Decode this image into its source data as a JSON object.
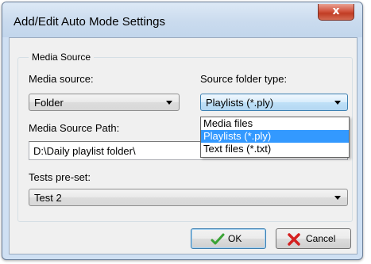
{
  "window": {
    "title": "Add/Edit Auto Mode Settings",
    "close_glyph": "x"
  },
  "group": {
    "legend": "Media Source"
  },
  "media_source": {
    "label": "Media source:",
    "value": "Folder"
  },
  "source_folder_type": {
    "label": "Source folder type:",
    "value": "Playlists (*.ply)",
    "options": [
      "Media files",
      "Playlists (*.ply)",
      "Text files (*.txt)"
    ],
    "selected_index": 1
  },
  "media_source_path": {
    "label": "Media Source Path:",
    "value": "D:\\Daily playlist folder\\"
  },
  "tests_preset": {
    "label": "Tests pre-set:",
    "value": "Test 2"
  },
  "buttons": {
    "ok": "OK",
    "cancel": "Cancel"
  },
  "icons": {
    "ok_icon": "checkmark-icon",
    "cancel_icon": "red-x-icon"
  },
  "colors": {
    "highlight": "#3399ff",
    "ok_check": "#3aa335",
    "cancel_x": "#d42020",
    "close_button": "#c9452e"
  }
}
